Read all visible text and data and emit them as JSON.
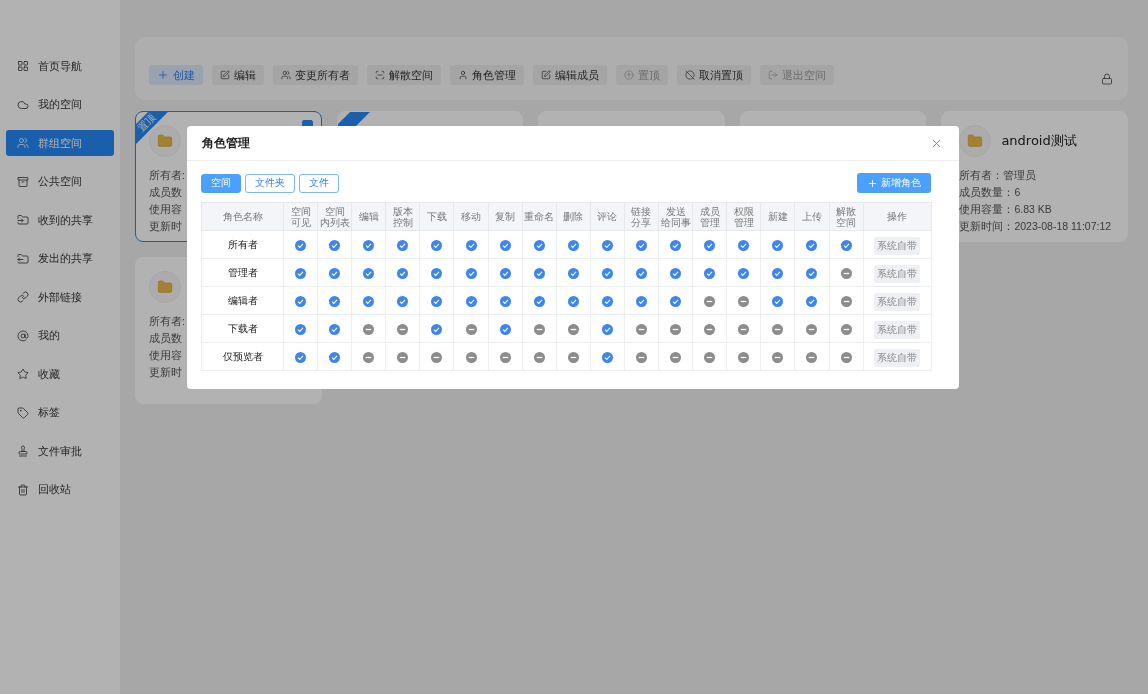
{
  "sidebar": {
    "items": [
      {
        "label": "首页导航",
        "selected": false
      },
      {
        "label": "我的空间",
        "selected": false
      },
      {
        "label": "群组空间",
        "selected": true
      },
      {
        "label": "公共空间",
        "selected": false
      },
      {
        "label": "收到的共享",
        "selected": false
      },
      {
        "label": "发出的共享",
        "selected": false
      },
      {
        "label": "外部链接",
        "selected": false
      },
      {
        "label": "我的",
        "selected": false
      },
      {
        "label": "收藏",
        "selected": false
      },
      {
        "label": "标签",
        "selected": false
      },
      {
        "label": "文件审批",
        "selected": false
      },
      {
        "label": "回收站",
        "selected": false
      }
    ]
  },
  "toolbar": {
    "buttons": [
      {
        "label": "创建",
        "kind": "primary",
        "disabled": false
      },
      {
        "label": "编辑",
        "kind": "default",
        "disabled": false
      },
      {
        "label": "变更所有者",
        "kind": "default",
        "disabled": false
      },
      {
        "label": "解散空间",
        "kind": "default",
        "disabled": false
      },
      {
        "label": "角色管理",
        "kind": "default",
        "disabled": false
      },
      {
        "label": "编辑成员",
        "kind": "default",
        "disabled": false
      },
      {
        "label": "置顶",
        "kind": "default",
        "disabled": true
      },
      {
        "label": "取消置顶",
        "kind": "default",
        "disabled": false
      },
      {
        "label": "退出空间",
        "kind": "default",
        "disabled": true
      }
    ]
  },
  "cards": [
    {
      "pinned": true,
      "pin_label": "置顶",
      "selected": true,
      "checked": true,
      "info": [
        "所有者:",
        "成员数",
        "使用容",
        "更新时"
      ]
    },
    {
      "pinned": true,
      "selected": false
    },
    {
      "pinned": false,
      "selected": false
    },
    {
      "pinned": false,
      "selected": false
    },
    {
      "pinned": false,
      "selected": false,
      "title": "android测试",
      "info": [
        "所有者：管理员",
        "成员数量：6",
        "使用容量：6.83 KB",
        "更新时间：2023-08-18 11:07:12"
      ]
    },
    {
      "pinned": false,
      "selected": false,
      "info": [
        "所有者:",
        "成员数",
        "使用容",
        "更新时"
      ]
    }
  ],
  "modal": {
    "title": "角色管理",
    "tabs": [
      {
        "label": "空间",
        "selected": true
      },
      {
        "label": "文件夹",
        "selected": false
      },
      {
        "label": "文件",
        "selected": false
      }
    ],
    "add_button": "新增角色",
    "columns": [
      [
        "角色名称"
      ],
      [
        "空间",
        "可见"
      ],
      [
        "空间",
        "内列表"
      ],
      [
        "编辑"
      ],
      [
        "版本",
        "控制"
      ],
      [
        "下载"
      ],
      [
        "移动"
      ],
      [
        "复制"
      ],
      [
        "重命名"
      ],
      [
        "删除"
      ],
      [
        "评论"
      ],
      [
        "链接",
        "分享"
      ],
      [
        "发送",
        "给同事"
      ],
      [
        "成员",
        "管理"
      ],
      [
        "权限",
        "管理"
      ],
      [
        "新建"
      ],
      [
        "上传"
      ],
      [
        "解散",
        "空间"
      ],
      [
        "操作"
      ]
    ],
    "roles": [
      {
        "name": "所有者",
        "perms": [
          true,
          true,
          true,
          true,
          true,
          true,
          true,
          true,
          true,
          true,
          true,
          true,
          true,
          true,
          true,
          true,
          true
        ],
        "action": "系统自带"
      },
      {
        "name": "管理者",
        "perms": [
          true,
          true,
          true,
          true,
          true,
          true,
          true,
          true,
          true,
          true,
          true,
          true,
          true,
          true,
          true,
          true,
          false
        ],
        "action": "系统自带"
      },
      {
        "name": "编辑者",
        "perms": [
          true,
          true,
          true,
          true,
          true,
          true,
          true,
          true,
          true,
          true,
          true,
          true,
          false,
          false,
          true,
          true,
          false
        ],
        "action": "系统自带"
      },
      {
        "name": "下载者",
        "perms": [
          true,
          true,
          false,
          false,
          true,
          false,
          true,
          false,
          false,
          true,
          false,
          false,
          false,
          false,
          false,
          false,
          false
        ],
        "action": "系统自带"
      },
      {
        "name": "仅预览者",
        "perms": [
          true,
          true,
          false,
          false,
          false,
          false,
          false,
          false,
          false,
          true,
          false,
          false,
          false,
          false,
          false,
          false,
          false
        ],
        "action": "系统自带"
      }
    ]
  }
}
